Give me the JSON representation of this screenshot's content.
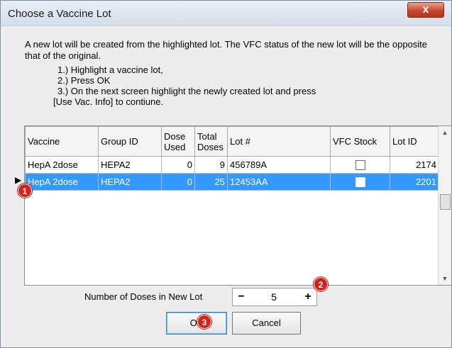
{
  "window": {
    "title": "Choose a Vaccine Lot",
    "close_glyph": "x"
  },
  "instructions": {
    "intro": "A new lot will be created from the highlighted lot. The VFC status of the new lot will be the opposite that of the original.",
    "step1": "1.) Highlight a vaccine lot,",
    "step2": "2.) Press OK",
    "step3": "3.) On the next screen highlight the newly created lot and press",
    "step4": "[Use Vac. Info] to  contiune."
  },
  "grid": {
    "columns": [
      "Vaccine",
      "Group ID",
      "Dose Used",
      "Total Doses",
      "Lot #",
      "VFC Stock",
      "Lot ID"
    ],
    "rows": [
      {
        "vaccine": "HepA 2dose",
        "group_id": "HEPA2",
        "dose_used": "0",
        "total_doses": "9",
        "lot": "456789A",
        "vfc_stock": false,
        "lot_id": "2174",
        "selected": false
      },
      {
        "vaccine": "HepA 2dose",
        "group_id": "HEPA2",
        "dose_used": "0",
        "total_doses": "25",
        "lot": "12453AA",
        "vfc_stock": false,
        "lot_id": "2201",
        "selected": true
      }
    ],
    "current_row_glyph": "▶",
    "scroll_up_glyph": "▲",
    "scroll_down_glyph": "▼"
  },
  "doses": {
    "label": "Number of Doses in New Lot",
    "value": "5",
    "minus": "−",
    "plus": "+"
  },
  "buttons": {
    "ok": "OK",
    "cancel": "Cancel"
  },
  "badges": [
    "1",
    "2",
    "3"
  ],
  "colors": {
    "selection": "#3399ff",
    "badge": "#d8201a",
    "close": "#c8492f"
  }
}
